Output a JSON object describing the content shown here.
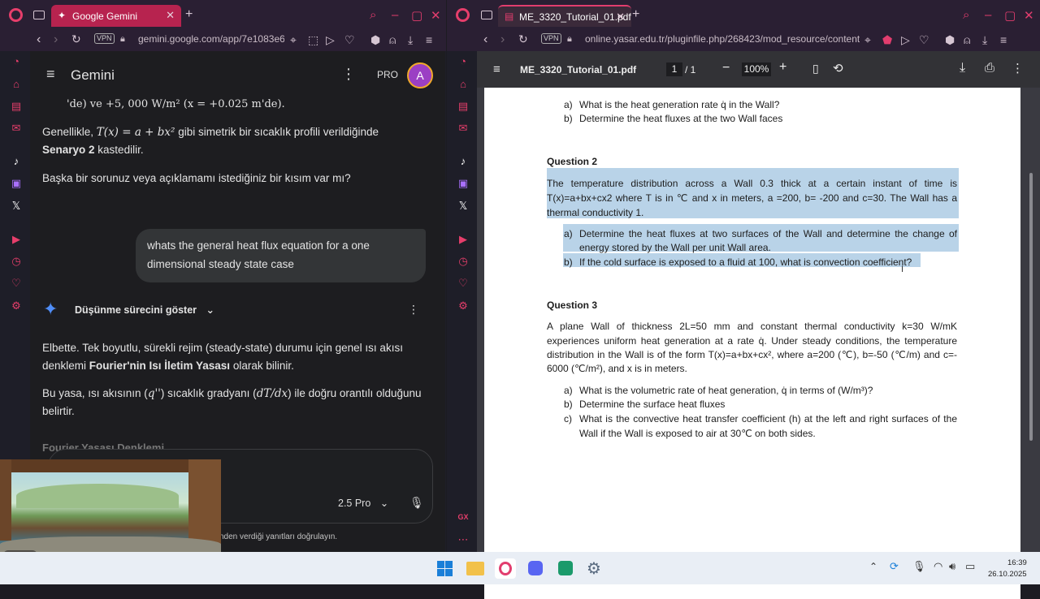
{
  "left_tab": {
    "title": "Google Gemini",
    "url": "gemini.google.com/app/7e1083e6:"
  },
  "right_tab": {
    "title": "ME_3320_Tutorial_01.pdf",
    "url": "online.yasar.edu.tr/pluginfile.php/268423/mod_resource/content/"
  },
  "vpn": "VPN",
  "gemini": {
    "title": "Gemini",
    "pro": "PRO",
    "avatar": "A",
    "p0": "'de) ve +5, 000 W/m² (x = +0.025 m'de).",
    "p1a": "Genellikle, ",
    "p1m": "T(x) = a + bx²",
    "p1b": " gibi simetrik bir sıcaklık profili verildiğinde",
    "p1c": "Senaryo 2",
    "p1d": " kastedilir.",
    "p2": "Başka bir sorunuz veya açıklamamı istediğiniz bir kısım var mı?",
    "user1": "whats the general heat flux equation for a one",
    "user2": "dimensional steady state case",
    "thinking": "Düşünme sürecini göster",
    "p3a": "Elbette. Tek boyutlu, sürekli rejim (steady-state) durumu için genel ısı akısı",
    "p3b": "denklemi ",
    "p3c": "Fourier'nin Isı İletim Yasası",
    "p3d": " olarak bilinir.",
    "p4a": "Bu yasa, ısı akısının (",
    "p4m1": "q''",
    "p4b": ") sıcaklık gradyanı (",
    "p4m2": "dT/dx",
    "p4c": ") ile doğru orantılı olduğunu",
    "p4e": "belirtir.",
    "cut": "Fourier Yasası Denklemi",
    "model": "2.5 Pro",
    "footer": "nden verdiği yanıtları doğrulayın."
  },
  "pdf": {
    "name": "ME_3320_Tutorial_01.pdf",
    "page": "1",
    "total": "/ 1",
    "zoom": "100%",
    "q1a_l": "a)",
    "q1a": "What is the heat generation rate q̇ in the Wall?",
    "q1b_l": "b)",
    "q1b": "Determine the heat fluxes at the two Wall faces",
    "q2": "Question 2",
    "q2l1": "The temperature distribution across a Wall 0.3 thick at a certain instant of time is",
    "q2l2": "T(x)=a+bx+cx2 where T is in ℃ and x in meters, a =200, b= -200 and c=30. The Wall has a",
    "q2l3": "thermal conductivity 1.",
    "q2a_l": "a)",
    "q2a1": "Determine the heat fluxes at two surfaces of the Wall and determine the change of",
    "q2a2": "energy stored by the Wall per unit Wall area.",
    "q2b_l": "b)",
    "q2b": "If the cold surface is exposed to a fluid at 100, what is convection coefficient?",
    "q3": "Question 3",
    "q3l1": "A plane Wall of thickness 2L=50 mm and constant thermal conductivity k=30 W/mK",
    "q3l2": "experiences uniform heat generation at a rate q̇. Under steady conditions, the temperature",
    "q3l3": "distribution in the Wall is of the form T(x)=a+bx+cx², where a=200 (℃), b=-50 (℃/m) and c=-",
    "q3l4": "6000 (℃/m²), and x is in meters.",
    "q3a_l": "a)",
    "q3a": "What is the volumetric rate of heat generation, q̇ in terms of (W/m³)?",
    "q3b_l": "b)",
    "q3b": "Determine the surface heat fluxes",
    "q3c_l": "c)",
    "q3c1": "What is the convective heat transfer coefficient (h) at the left and right surfaces of the",
    "q3c2": "Wall if the Wall is exposed to air at 30℃ on both sides."
  },
  "taskbar": {
    "time": "16:39",
    "date": "26.10.2025"
  },
  "colors": {
    "accent": "#e23d6e",
    "highlight": "#b9d3e8"
  }
}
